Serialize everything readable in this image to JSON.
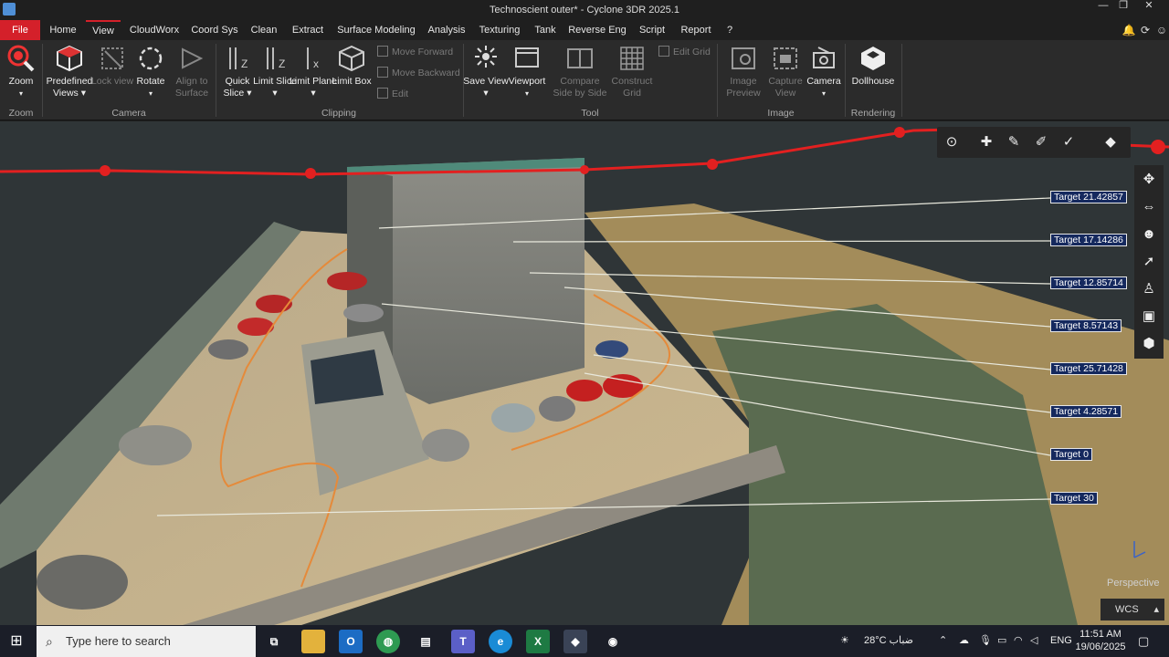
{
  "window": {
    "title": "Technoscient outer* - Cyclone 3DR 2025.1",
    "controls": {
      "minimize": "—",
      "restore": "❐",
      "close": "✕"
    }
  },
  "menu": {
    "items": [
      "File",
      "Home",
      "View",
      "CloudWorx",
      "Coord Sys",
      "Clean",
      "Extract",
      "Surface Modeling",
      "Analysis",
      "Texturing",
      "Tank",
      "Reverse Eng",
      "Script",
      "Report",
      "?"
    ],
    "active": "View"
  },
  "ribbon": {
    "zoom": {
      "label": "Zoom",
      "group": "Zoom"
    },
    "camera": {
      "predefined_views": "Predefined Views",
      "lock_view": "Lock view",
      "rotate": "Rotate",
      "align_to_surface": "Align to Surface",
      "group": "Camera"
    },
    "clipping": {
      "quick_slice": "Quick Slice",
      "limit_slice": "Limit Slice",
      "limit_plane": "Limit Plane",
      "limit_box": "Limit Box",
      "move_forward": "Move Forward",
      "move_backward": "Move Backward",
      "edit": "Edit",
      "group": "Clipping"
    },
    "tool": {
      "save_view": "Save View",
      "viewport": "Viewport",
      "compare_side_by_side": "Compare Side by Side",
      "construct_grid": "Construct Grid",
      "edit_grid": "Edit Grid",
      "group": "Tool"
    },
    "image": {
      "image_preview": "Image Preview",
      "capture_view": "Capture View",
      "camera": "Camera",
      "group": "Image"
    },
    "rendering": {
      "dollhouse": "Dollhouse",
      "group": "Rendering"
    }
  },
  "viewport": {
    "targets": [
      "Target 21.42857",
      "Target 17.14286",
      "Target 12.85714",
      "Target 8.57143",
      "Target 25.71428",
      "Target 4.28571",
      "Target 0",
      "Target 30"
    ],
    "projection": "Perspective",
    "coordinate_system": "WCS"
  },
  "taskbar": {
    "search_placeholder": "Type here to search",
    "weather": "28°C  ضباب",
    "language": "ENG",
    "time": "11:51 AM",
    "date": "19/06/2025"
  },
  "colors": {
    "accent": "#d4202a",
    "target_label_bg": "#15295e",
    "trajectory": "#e22020"
  }
}
